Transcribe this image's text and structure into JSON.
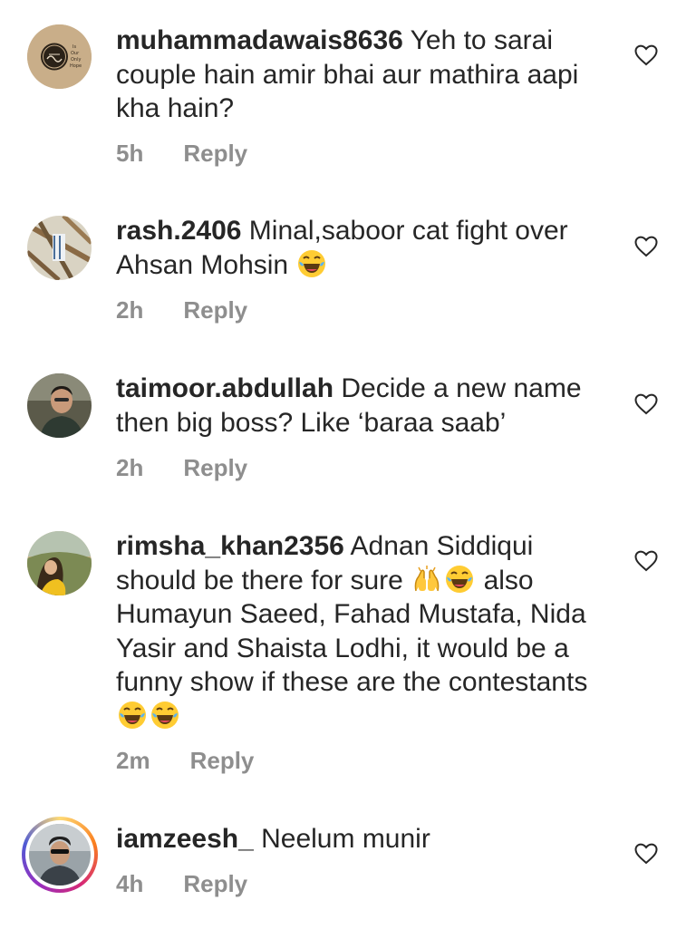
{
  "comments": [
    {
      "username": "muhammadawais8636",
      "text": "Yeh to sarai couple hain amir bhai aur mathira aapi kha hain?",
      "time": "5h",
      "reply": "Reply",
      "avatar_icon": "calligraphy-avatar-icon",
      "avatar_caption": "Is Our Only Hope"
    },
    {
      "username": "rash.2406",
      "text": "Minal,saboor cat fight over Ahsan Mohsin",
      "emoji": "😂",
      "time": "2h",
      "reply": "Reply",
      "avatar_icon": "photo-avatar-icon"
    },
    {
      "username": "taimoor.abdullah",
      "text": "Decide a new name then big boss? Like ‘baraa saab’",
      "time": "2h",
      "reply": "Reply",
      "avatar_icon": "photo-avatar-icon"
    },
    {
      "username": "rimsha_khan2356",
      "text_part1": "Adnan Siddiqui should be there for sure",
      "emoji_a": "🙌",
      "emoji_b": "😂",
      "text_part2": "also Humayun Saeed, Fahad Mustafa, Nida Yasir and Shaista Lodhi, it would be a funny show if these are the contestants",
      "emoji_c": "😂",
      "emoji_d": "😂",
      "time": "2m",
      "reply": "Reply",
      "avatar_icon": "photo-avatar-icon"
    },
    {
      "username": "iamzeesh_",
      "text": "Neelum munir",
      "time": "4h",
      "reply": "Reply",
      "avatar_icon": "story-ring-avatar-icon"
    }
  ],
  "icons": {
    "like": "heart-outline-icon"
  },
  "colors": {
    "text": "#262626",
    "meta": "#8e8e8e",
    "heart_stroke": "#262626"
  }
}
